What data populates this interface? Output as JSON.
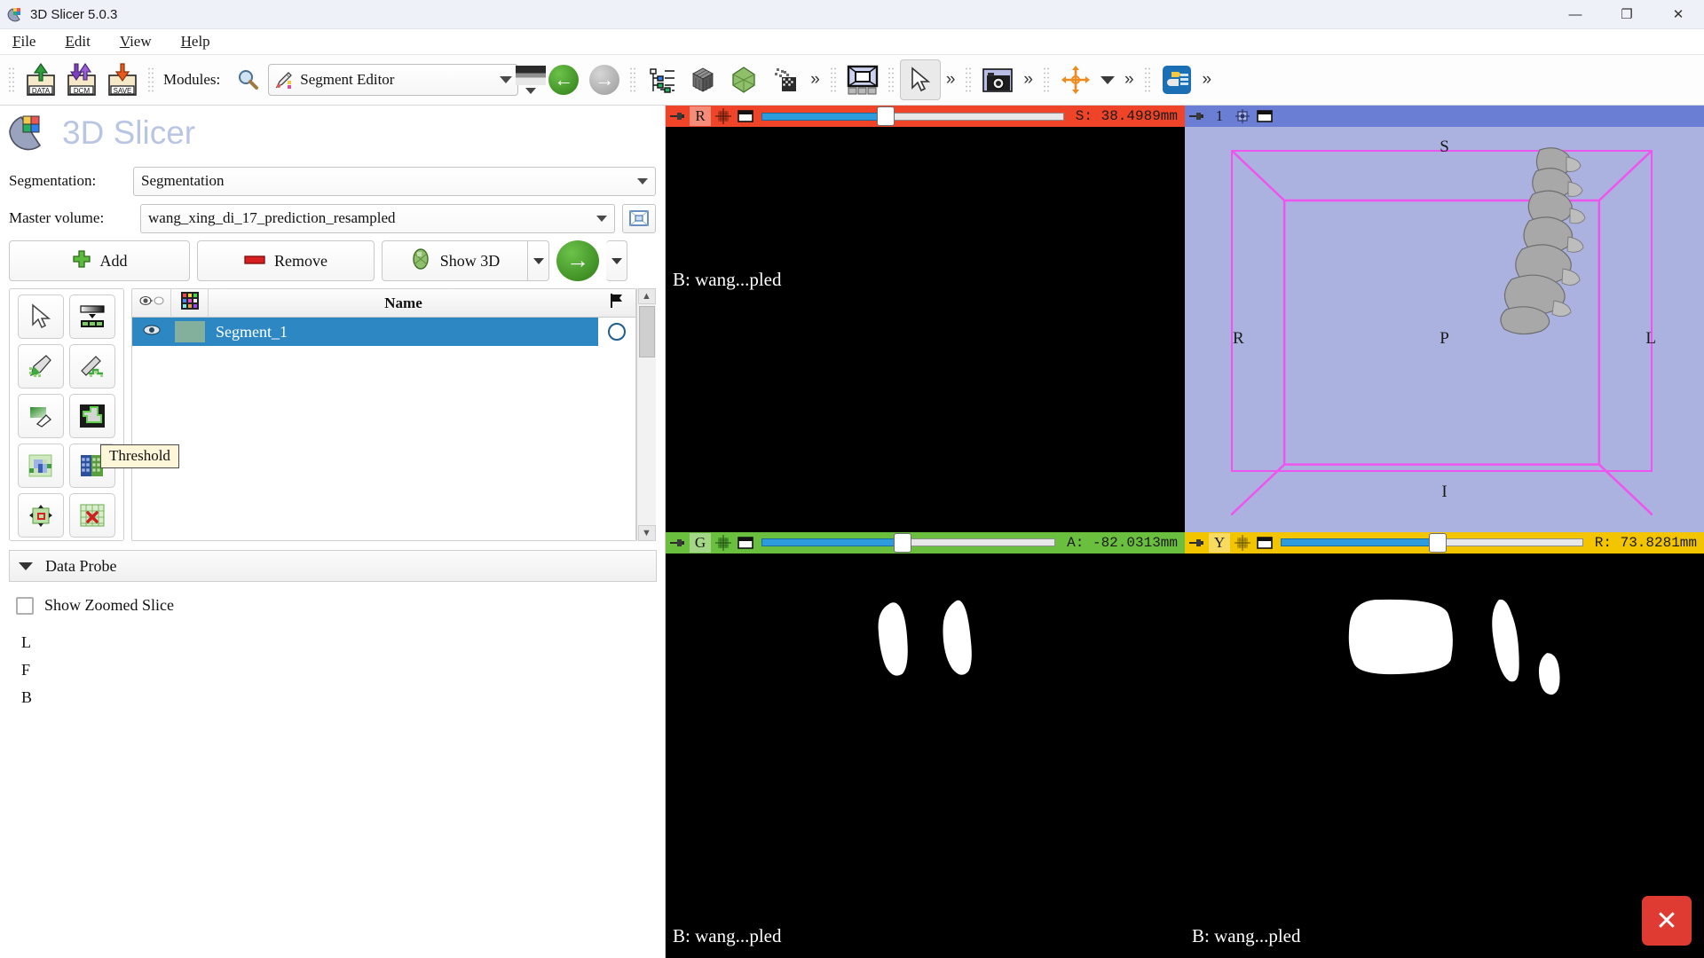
{
  "window": {
    "title": "3D Slicer 5.0.3",
    "icon": "slicer-logo-icon",
    "minimize": "—",
    "maximize": "❐",
    "close": "✕"
  },
  "menubar": {
    "items": [
      {
        "label": "File",
        "mnemonic": "F"
      },
      {
        "label": "Edit",
        "mnemonic": "E"
      },
      {
        "label": "View",
        "mnemonic": "V"
      },
      {
        "label": "Help",
        "mnemonic": "H"
      }
    ]
  },
  "toolbar": {
    "load_data_label": "DATA",
    "load_dicom_label": "DCM",
    "save_label": "SAVE",
    "modules_label": "Modules:",
    "search_icon": "magnifier-icon",
    "module_selected": "Segment Editor",
    "module_icon": "segment-editor-icon",
    "back_arrow": "←",
    "forward_arrow": "→",
    "overflow": "»"
  },
  "panel": {
    "logo_text": "3D Slicer",
    "segmentation_label": "Segmentation:",
    "segmentation_value": "Segmentation",
    "master_volume_label": "Master volume:",
    "master_volume_value": "wang_xing_di_17_prediction_resampled",
    "add_label": "Add",
    "remove_label": "Remove",
    "show3d_label": "Show 3D",
    "table": {
      "col_visibility": "eye-icon",
      "col_color": "color-palette-icon",
      "col_name": "Name",
      "col_flag": "flag-icon",
      "rows": [
        {
          "name": "Segment_1",
          "color": "#83b09c",
          "visible": true,
          "selected": true
        }
      ]
    },
    "effects": [
      {
        "name": "none-effect",
        "icon": "cursor-arrow-icon"
      },
      {
        "name": "threshold-effect",
        "icon": "threshold-icon"
      },
      {
        "name": "paint-effect",
        "icon": "paint-brush-icon"
      },
      {
        "name": "draw-effect",
        "icon": "draw-pencil-icon"
      },
      {
        "name": "erase-effect",
        "icon": "eraser-icon"
      },
      {
        "name": "level-tracing-effect",
        "icon": "level-tracing-icon"
      },
      {
        "name": "grow-from-seeds-effect",
        "icon": "grow-from-seeds-icon"
      },
      {
        "name": "fill-between-slices-effect",
        "icon": "fill-between-slices-icon"
      },
      {
        "name": "scissors-effect",
        "icon": "scissors-icon"
      },
      {
        "name": "islands-effect",
        "icon": "islands-icon"
      }
    ],
    "tooltip": "Threshold",
    "data_probe_label": "Data Probe",
    "show_zoomed_slice_label": "Show Zoomed Slice",
    "axis_letters": [
      "L",
      "F",
      "B"
    ]
  },
  "views": [
    {
      "name": "red-slice-view",
      "color": "#ef4427",
      "letter": "R",
      "coordinate": "S: 38.4989mm",
      "slider_percent": 41,
      "volume_label": "B: wang...pled"
    },
    {
      "name": "3d-view",
      "color": "#6a7fd4",
      "letter": "1",
      "coordinate": "",
      "orientation": {
        "S": "S",
        "I": "I",
        "R": "R",
        "L": "L",
        "P": "P"
      }
    },
    {
      "name": "green-slice-view",
      "color": "#6bbf3e",
      "letter": "G",
      "coordinate": "A: -82.0313mm",
      "slider_percent": 48,
      "volume_label": "B: wang...pled"
    },
    {
      "name": "yellow-slice-view",
      "color": "#f2c500",
      "letter": "Y",
      "coordinate": "R: 73.8281mm",
      "slider_percent": 52,
      "volume_label": "B: wang...pled"
    }
  ],
  "overlay": {
    "close_button": "✕"
  }
}
